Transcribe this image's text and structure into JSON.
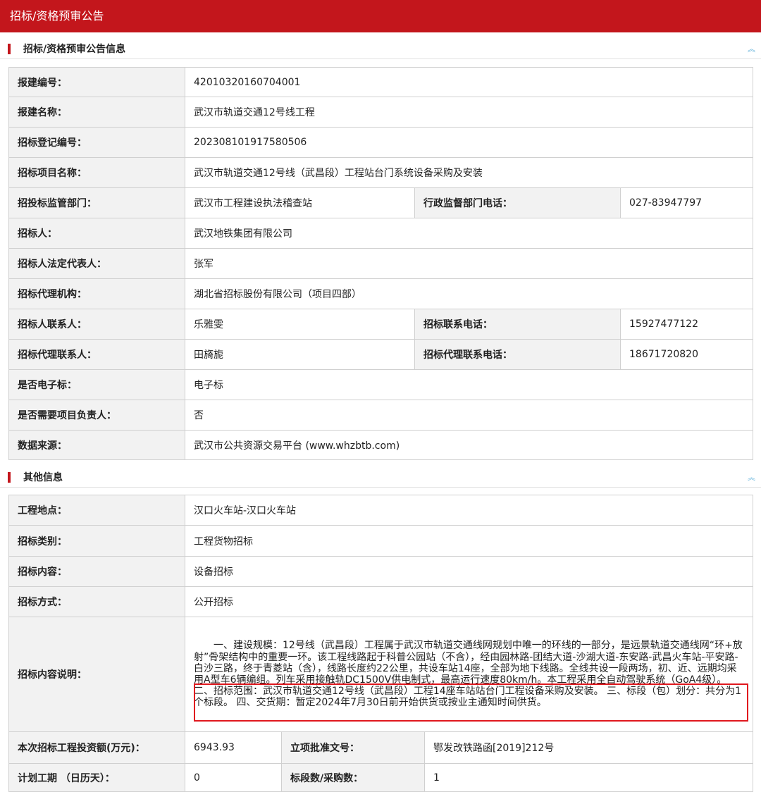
{
  "title": "招标/资格预审公告",
  "collapse_icon_glyph": "︽",
  "highlight_color": "#e0181e",
  "sections": [
    {
      "title": "招标/资格预审公告信息",
      "rows": [
        {
          "label": "报建编号：",
          "value": "42010320160704001"
        },
        {
          "label": "报建名称：",
          "value": "武汉市轨道交通12号线工程"
        },
        {
          "label": "招标登记编号：",
          "value": "202308101917580506"
        },
        {
          "label": "招标项目名称：",
          "value": "武汉市轨道交通12号线（武昌段）工程站台门系统设备采购及安装"
        },
        {
          "label": "招投标监管部门：",
          "value": "武汉市工程建设执法稽查站",
          "label2": "行政监督部门电话：",
          "value2": "027-83947797"
        },
        {
          "label": "招标人：",
          "value": "武汉地铁集团有限公司"
        },
        {
          "label": "招标人法定代表人：",
          "value": "张军"
        },
        {
          "label": "招标代理机构：",
          "value": "湖北省招标股份有限公司（项目四部）"
        },
        {
          "label": "招标人联系人：",
          "value": "乐雅雯",
          "label2": "招标联系电话：",
          "value2": "15927477122"
        },
        {
          "label": "招标代理联系人：",
          "value": "田旖旎",
          "label2": "招标代理联系电话：",
          "value2": "18671720820"
        },
        {
          "label": "是否电子标：",
          "value": "电子标"
        },
        {
          "label": "是否需要项目负责人：",
          "value": "否"
        },
        {
          "label": "数据来源：",
          "value": "武汉市公共资源交易平台 (www.whzbtb.com)"
        }
      ]
    },
    {
      "title": "其他信息",
      "rows": [
        {
          "label": "工程地点：",
          "value": "汉口火车站-汉口火车站"
        },
        {
          "label": "招标类别：",
          "value": "工程货物招标"
        },
        {
          "label": "招标内容：",
          "value": "设备招标"
        },
        {
          "label": "招标方式：",
          "value": "公开招标"
        },
        {
          "label": "招标内容说明：",
          "value": "　　一、建设规模：12号线（武昌段）工程属于武汉市轨道交通线网规划中唯一的环线的一部分，是远景轨道交通线网“环+放射”骨架结构中的重要一环。该工程线路起于科普公园站（不含），经由园林路-团结大道-沙湖大道-东安路-武昌火车站-平安路-白沙三路，终于青菱站（含），线路长度约22公里，共设车站14座，全部为地下线路。全线共设一段两场，初、近、远期均采用A型车6辆编组。列车采用接触轨DC1500V供电制式，最高运行速度80km/h。本工程采用全自动驾驶系统（GoA4级）。 二、招标范围：武汉市轨道交通12号线（武昌段）工程14座车站站台门工程设备采购及安装。 三、标段（包）划分：共分为1个标段。 四、交货期：暂定2024年7月30日前开始供货或按业主通知时间供货。"
        },
        {
          "label": "本次招标工程投资额(万元)：",
          "value": "6943.93",
          "label2": "立项批准文号：",
          "value2": "鄂发改铁路函[2019]212号"
        },
        {
          "label": "计划工期 （日历天）：",
          "value": "0",
          "label2": "标段数/采购数：",
          "value2": "1"
        }
      ]
    }
  ]
}
